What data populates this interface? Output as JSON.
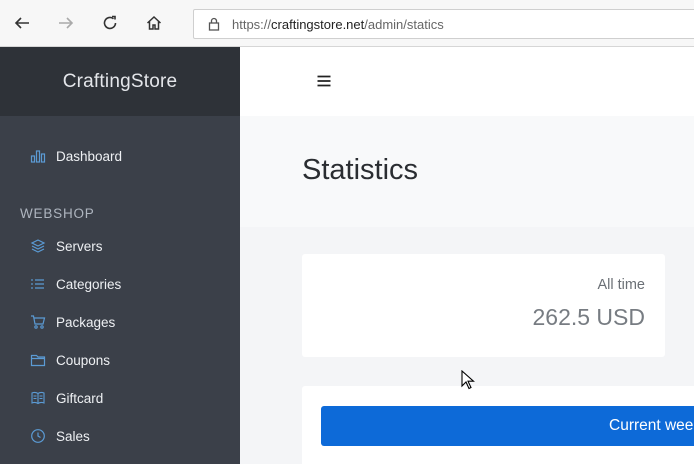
{
  "browser": {
    "url_scheme": "https://",
    "url_host": "craftingstore.net",
    "url_path": "/admin/statics"
  },
  "sidebar": {
    "brand": "CraftingStore",
    "dashboard_label": "Dashboard",
    "section_title": "WEBSHOP",
    "items": [
      {
        "label": "Servers",
        "icon": "layers-icon"
      },
      {
        "label": "Categories",
        "icon": "list-icon"
      },
      {
        "label": "Packages",
        "icon": "cart-icon"
      },
      {
        "label": "Coupons",
        "icon": "folder-icon"
      },
      {
        "label": "Giftcard",
        "icon": "book-icon"
      },
      {
        "label": "Sales",
        "icon": "clock-icon"
      }
    ]
  },
  "main": {
    "page_title": "Statistics",
    "stat": {
      "label": "All time",
      "value": "262.5 USD"
    },
    "tab_label": "Current week"
  },
  "colors": {
    "sidebar_bg": "#3b4049",
    "brand_bg": "#2e3238",
    "accent": "#0d6ad8",
    "icon_blue": "#5b9bd5"
  }
}
